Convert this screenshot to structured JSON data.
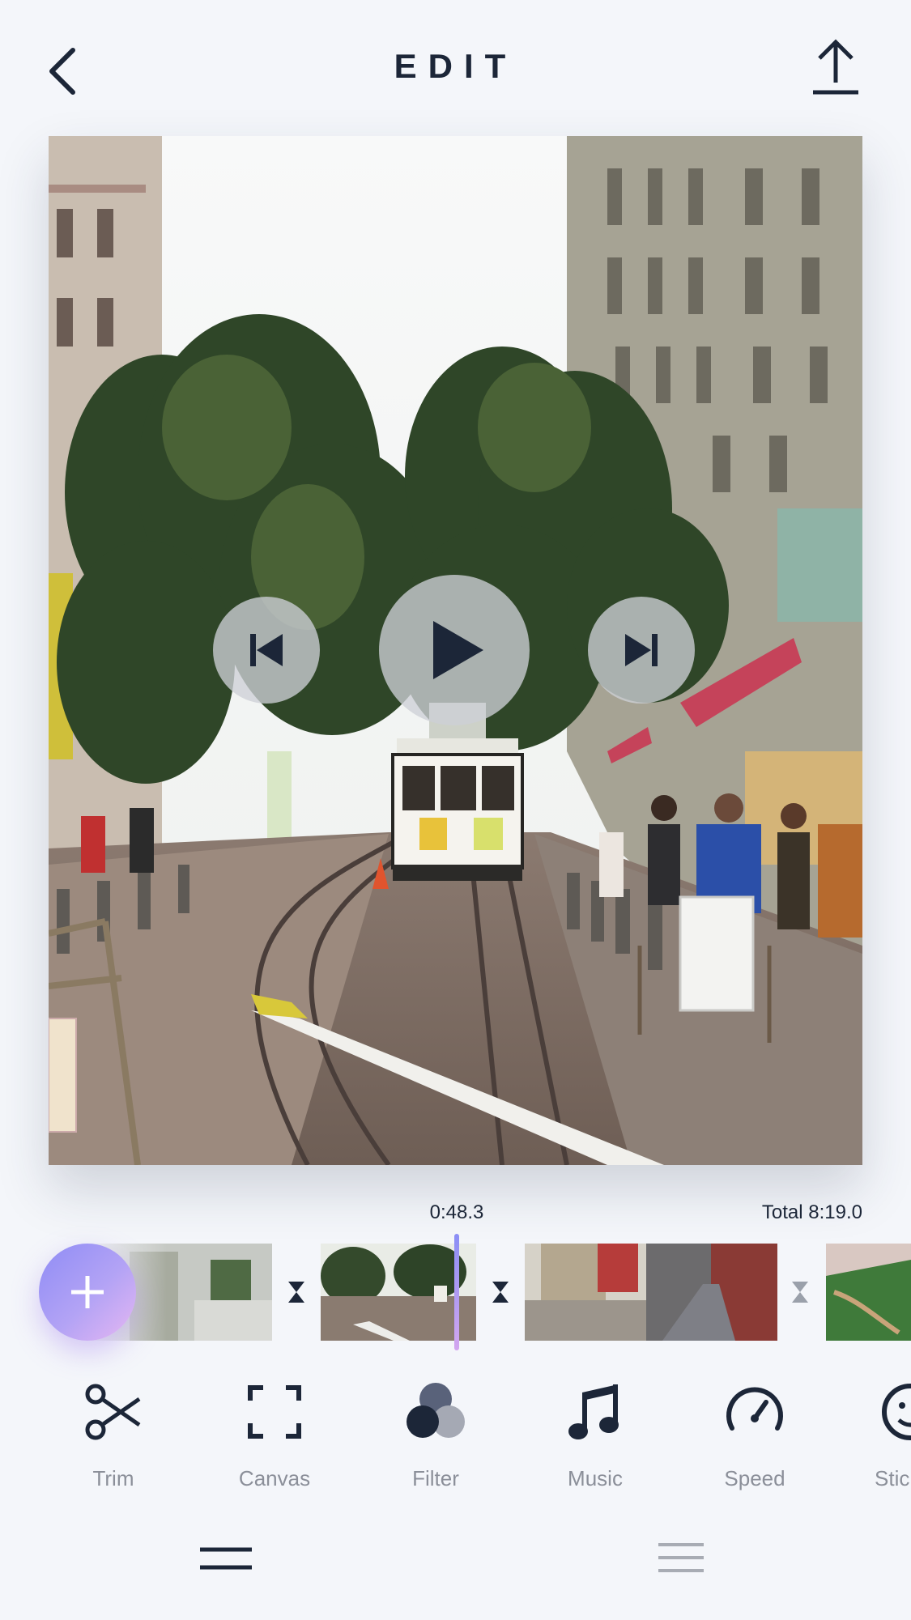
{
  "header": {
    "title": "EDIT",
    "back_icon": "chevron-left-icon",
    "export_icon": "upload-icon"
  },
  "player": {
    "prev_icon": "skip-previous-icon",
    "play_icon": "play-icon",
    "next_icon": "skip-next-icon"
  },
  "timeline": {
    "current_time": "0:48.3",
    "total_time": "Total 8:19.0",
    "add_icon": "plus-icon",
    "playhead_progress": 0.097
  },
  "tools": [
    {
      "label": "Trim",
      "icon": "scissors-icon"
    },
    {
      "label": "Canvas",
      "icon": "canvas-crop-icon"
    },
    {
      "label": "Filter",
      "icon": "filter-circles-icon"
    },
    {
      "label": "Music",
      "icon": "music-note-icon"
    },
    {
      "label": "Speed",
      "icon": "speedometer-icon"
    },
    {
      "label": "Stic",
      "icon": "sticker-smile-icon"
    }
  ],
  "bottom_tabs": [
    {
      "icon": "double-line-icon",
      "active": true
    },
    {
      "icon": "triple-line-icon",
      "active": false
    }
  ],
  "colors": {
    "background": "#f4f6fa",
    "text_dark": "#1c2638",
    "text_muted": "#8b8f99",
    "accent_start": "#8f8cf5",
    "accent_end": "#e6b7f2"
  }
}
